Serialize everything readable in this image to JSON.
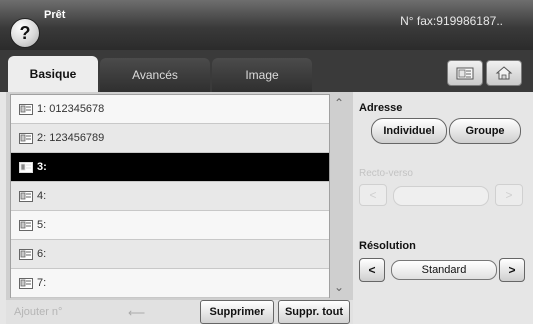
{
  "header": {
    "status": "Prêt",
    "fax_number": "N° fax:919986187.."
  },
  "tabs": [
    {
      "label": "Basique",
      "active": true
    },
    {
      "label": "Avancés",
      "active": false
    },
    {
      "label": "Image",
      "active": false
    }
  ],
  "toolbar": {
    "icons": [
      "phonebook-icon",
      "home-icon"
    ]
  },
  "list": {
    "rows": [
      {
        "text": "1: 012345678",
        "selected": false
      },
      {
        "text": "2: 123456789",
        "selected": false
      },
      {
        "text": "3:",
        "selected": true
      },
      {
        "text": "4:",
        "selected": false
      },
      {
        "text": "5:",
        "selected": false
      },
      {
        "text": "6:",
        "selected": false
      },
      {
        "text": "7:",
        "selected": false
      }
    ]
  },
  "bottom": {
    "placeholder": "Ajouter n°",
    "delete_label": "Supprimer",
    "delete_all_label": "Suppr. tout"
  },
  "right": {
    "address_label": "Adresse",
    "individual_label": "Individuel",
    "group_label": "Groupe",
    "disabled_label": "Recto-verso",
    "resolution_label": "Résolution",
    "resolution_value": "Standard"
  },
  "colors": {
    "header_dark": "#2b2b2b",
    "selected_row": "#000000"
  }
}
